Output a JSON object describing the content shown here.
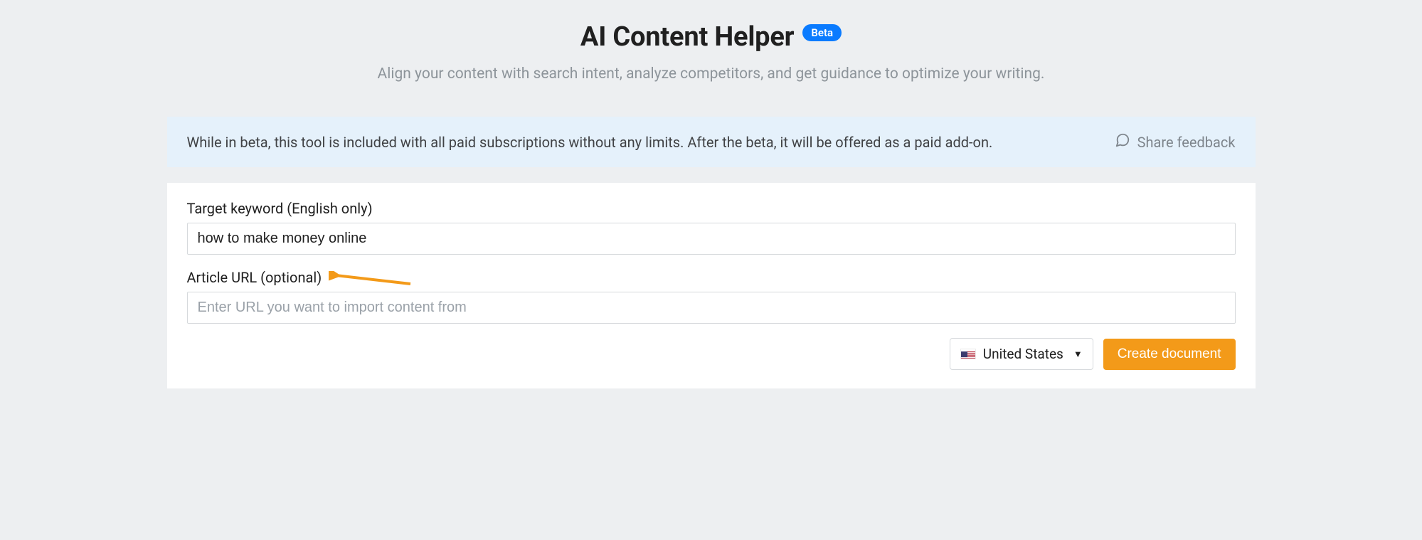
{
  "header": {
    "title": "AI Content Helper",
    "badge": "Beta",
    "subtitle": "Align your content with search intent, analyze competitors, and get guidance to optimize your writing."
  },
  "banner": {
    "text": "While in beta, this tool is included with all paid subscriptions without any limits. After the beta, it will be offered as a paid add-on.",
    "feedback_label": "Share feedback"
  },
  "form": {
    "keyword_label": "Target keyword (English only)",
    "keyword_value": "how to make money online",
    "url_label": "Article URL (optional)",
    "url_placeholder": "Enter URL you want to import content from",
    "url_value": ""
  },
  "actions": {
    "country_label": "United States",
    "create_label": "Create document"
  },
  "colors": {
    "accent_blue": "#0a7bff",
    "accent_orange": "#f39a19",
    "banner_bg": "#e5f1fb"
  }
}
